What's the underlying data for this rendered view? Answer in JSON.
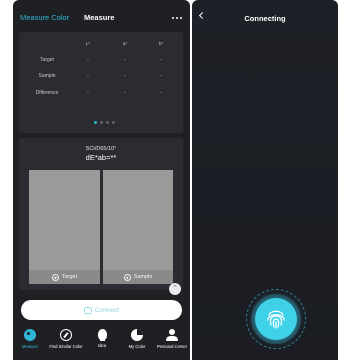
{
  "left_screen": {
    "header": {
      "tab_active": "Measure Color",
      "tab_current": "Measure"
    },
    "table": {
      "columns": [
        "L*",
        "a*",
        "b*"
      ],
      "rows": [
        {
          "label": "Target",
          "values": [
            "-",
            "-",
            "-"
          ]
        },
        {
          "label": "Sample",
          "values": [
            "-",
            "-",
            "-"
          ]
        },
        {
          "label": "Difference",
          "values": [
            "-",
            "-",
            "-"
          ]
        }
      ]
    },
    "compare": {
      "illuminant": "SCI/D65/10°",
      "delta_e": "dE*ab=**",
      "target_label": "Target",
      "sample_label": "Sample",
      "swatch_color": "#9a9a9a"
    },
    "connect_label": "Connect",
    "nav": [
      {
        "label": "Measure",
        "icon": "palette-icon",
        "active": true
      },
      {
        "label": "Find Similar Color",
        "icon": "compass-icon",
        "active": false
      },
      {
        "label": "Idea",
        "icon": "bulb-icon",
        "active": false
      },
      {
        "label": "My Color",
        "icon": "pie-chart-icon",
        "active": false
      },
      {
        "label": "Personal Center",
        "icon": "person-icon",
        "active": false
      }
    ],
    "accent_color": "#2fb7d6"
  },
  "right_screen": {
    "title": "Connecting",
    "accent_color": "#3fd1e8"
  }
}
